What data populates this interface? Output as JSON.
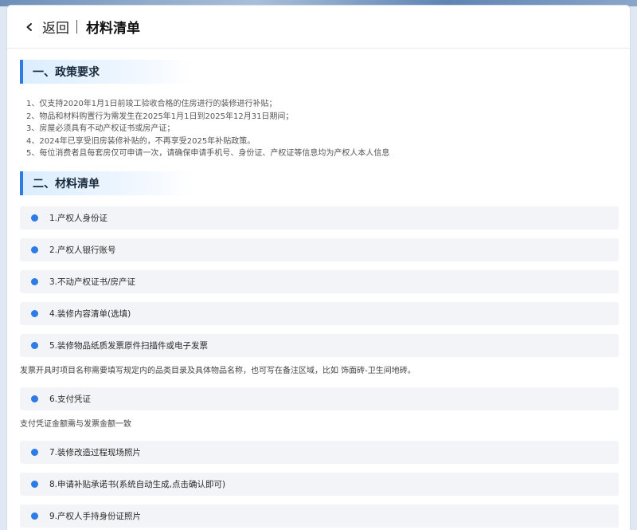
{
  "header": {
    "back_label": "返回",
    "title": "材料清单"
  },
  "section1": {
    "title": "一、政策要求",
    "items": [
      "1、仅支持2020年1月1日前竣工验收合格的住房进行的装修进行补贴；",
      "2、物品和材料购置行为需发生在2025年1月1日到2025年12月31日期间；",
      "3、房屋必须具有不动产权证书或房产证；",
      "4、2024年已享受旧房装修补贴的，不再享受2025年补贴政策。",
      "5、每位消费者且每套房仅可申请一次，请确保申请手机号、身份证、产权证等信息均为产权人本人信息"
    ]
  },
  "section2": {
    "title": "二、材料清单",
    "items": [
      "1.产权人身份证",
      "2.产权人银行账号",
      "3.不动产权证书/房产证",
      "4.装修内容清单(选填)",
      "5.装修物品纸质发票原件扫描件或电子发票",
      "6.支付凭证",
      "7.装修改造过程现场照片",
      "8.申请补贴承诺书(系统自动生成,点击确认即可)",
      "9.产权人手持身份证照片"
    ],
    "note_invoice": "发票开具时项目名称需要填写规定内的品类目录及具体物品名称，也可写在备注区域，比如 饰面砖-卫生间地砖。",
    "note_payment": "支付凭证金额需与发票金额一致"
  },
  "colors": {
    "accent": "#2f7be6",
    "item_bg": "#f2f4f7"
  },
  "icons": {
    "back": "chevron-left-icon",
    "bullet": "dot-icon"
  }
}
